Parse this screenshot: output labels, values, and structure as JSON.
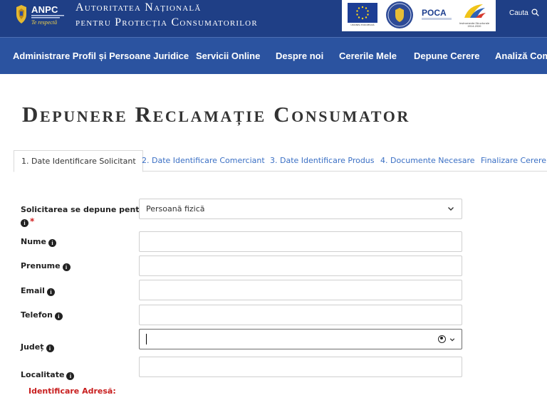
{
  "header": {
    "logo_text": "ANPC",
    "logo_slogan": "Te respectă",
    "org_name_line1": "Autoritatea Națională",
    "org_name_line2": "pentru Protecția Consumatorilor",
    "partners": {
      "eu_caption": "UNIUNEA EUROPEANĂ",
      "poca_text": "POCA",
      "structural_caption": "Instrumente Structurale 2014-2020"
    },
    "search_label": "Cauta"
  },
  "nav": {
    "items": [
      "Administrare Profil și Persoane Juridice",
      "Servicii Online",
      "Despre noi",
      "Cererile Mele",
      "Depune Cerere",
      "Analiză Comp"
    ]
  },
  "page": {
    "title": "Depunere Reclamație Consumator"
  },
  "tabs": [
    "1. Date Identificare Solicitant",
    "2. Date Identificare Comerciant",
    "3. Date Identificare Produs",
    "4. Documente Necesare",
    "Finalizare Cerere"
  ],
  "form": {
    "solicitare_label": "Solicitarea se depune pentru:",
    "solicitare_value": "Persoană fizică",
    "required_mark": "*",
    "nume_label": "Nume",
    "prenume_label": "Prenume",
    "email_label": "Email",
    "telefon_label": "Telefon",
    "judet_label": "Județ",
    "localitate_label": "Localitate",
    "adresa_header": "Identificare Adresă:",
    "info_glyph": "i"
  },
  "colors": {
    "header_bg": "#1f3f86",
    "nav_bg": "#2b53a0",
    "link": "#3a6fc4",
    "required": "#d21f1f"
  }
}
